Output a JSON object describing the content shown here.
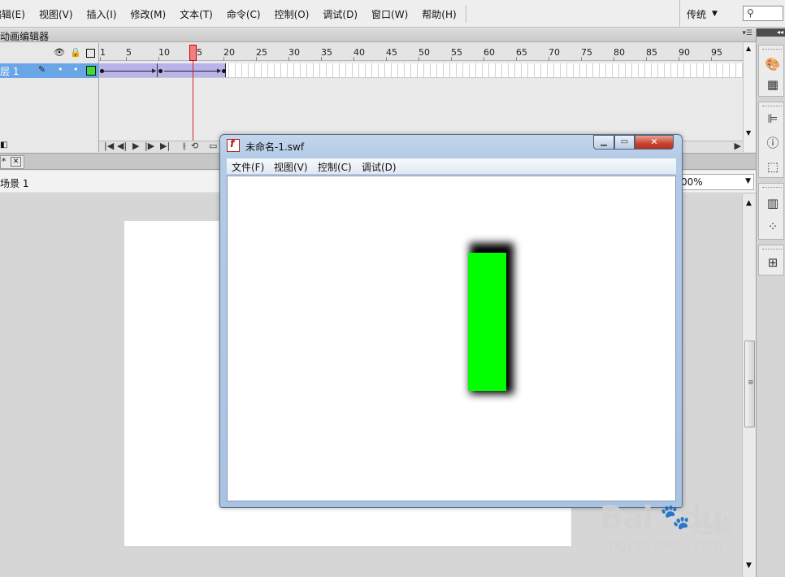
{
  "menubar": {
    "items": [
      "编辑(E)",
      "视图(V)",
      "插入(I)",
      "修改(M)",
      "文本(T)",
      "命令(C)",
      "控制(O)",
      "调试(D)",
      "窗口(W)",
      "帮助(H)"
    ],
    "workspace": "传统"
  },
  "timeline": {
    "panel_title": "动画编辑器",
    "layer_name": "层 1",
    "ruler_labels": [
      "1",
      "5",
      "10",
      "15",
      "20",
      "25",
      "30",
      "35",
      "40",
      "45",
      "50",
      "55",
      "60",
      "65",
      "70",
      "75",
      "80",
      "85",
      "90",
      "95"
    ],
    "current_frame": 15,
    "layer_color": "#3ddc3d",
    "tween_color": "#b8b3ea"
  },
  "document": {
    "tab_label": "*",
    "scene_label": "场景 1",
    "zoom": "00%"
  },
  "swf_window": {
    "title": "未命名-1.swf",
    "menus": [
      "文件(F)",
      "视图(V)",
      "控制(C)",
      "调试(D)"
    ],
    "shape_color": "#00ff00"
  },
  "right_panel": {
    "icons": [
      "color-palette-icon",
      "swatches-icon",
      "align-icon",
      "info-icon",
      "transform-icon",
      "library-icon",
      "motion-presets-icon",
      "project-icon"
    ]
  },
  "watermark": {
    "brand": "Bai",
    "brand2": "du",
    "cn": "经验",
    "url": "jingyan.baidu.com"
  }
}
